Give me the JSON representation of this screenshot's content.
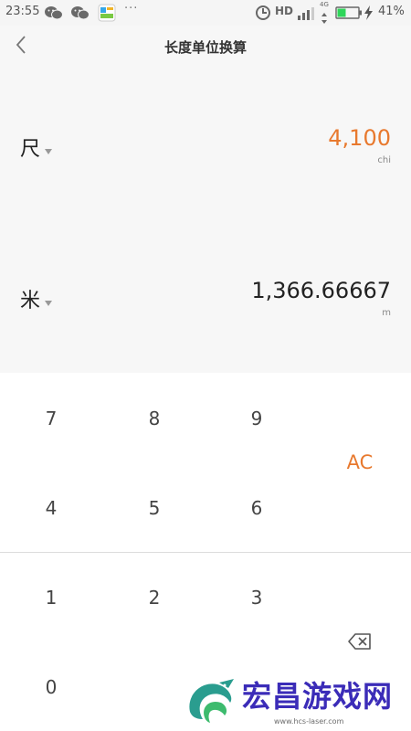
{
  "status_bar": {
    "time": "23:55",
    "network_label": "HD",
    "network_gen": "4G",
    "battery_percent": "41%",
    "overflow": "···",
    "battery_level": 0.41,
    "accent": "#2ed65a"
  },
  "header": {
    "title": "长度单位换算"
  },
  "converter": {
    "from": {
      "unit": "尺",
      "value": "4,100",
      "abbr": "chi"
    },
    "to": {
      "unit": "米",
      "value": "1,366.66667",
      "abbr": "m"
    }
  },
  "keypad": {
    "k7": "7",
    "k8": "8",
    "k9": "9",
    "k4": "4",
    "k5": "5",
    "k6": "6",
    "k1": "1",
    "k2": "2",
    "k3": "3",
    "k0": "0",
    "clear": "AC",
    "backspace_icon": "backspace-icon"
  },
  "watermark": {
    "brand": "宏昌游戏网",
    "url": "www.hcs-laser.com"
  },
  "colors": {
    "accent": "#e8792e",
    "display_bg": "#f7f7f7",
    "watermark": "#3b2cb8"
  }
}
